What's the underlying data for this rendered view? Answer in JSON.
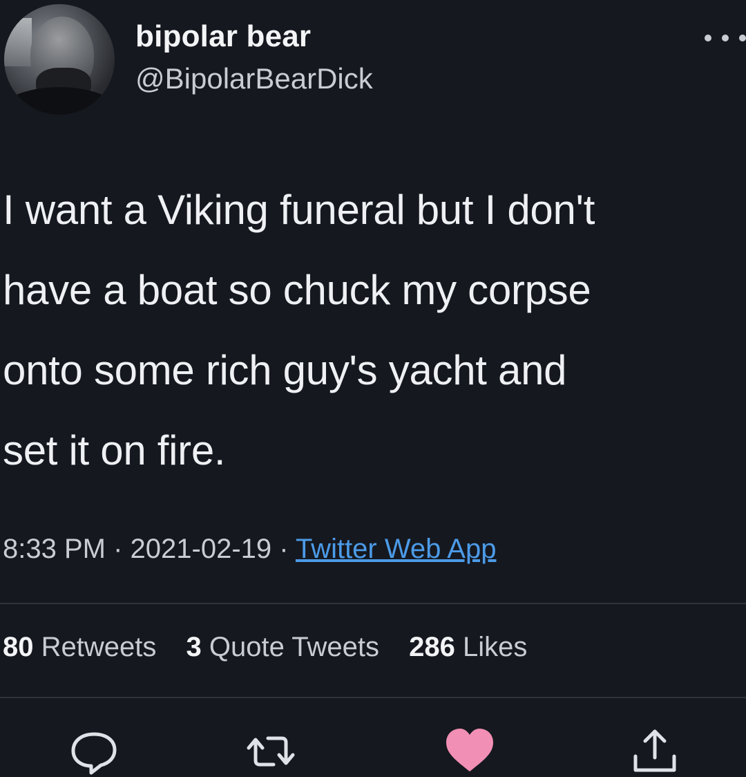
{
  "user": {
    "display_name": "bipolar bear",
    "handle": "@BipolarBearDick",
    "avatar_icon": "profile-photo"
  },
  "tweet": {
    "text_lines": [
      "I want a Viking funeral but I don't",
      "have a boat so chuck my corpse",
      "onto some rich guy's yacht and",
      "set it on fire."
    ]
  },
  "meta": {
    "time": "8:33 PM",
    "separator": " · ",
    "date": "2021-02-19",
    "source": "Twitter Web App"
  },
  "stats": {
    "retweets_count": "80",
    "retweets_label": "Retweets",
    "quotes_count": "3",
    "quotes_label": "Quote Tweets",
    "likes_count": "286",
    "likes_label": "Likes"
  },
  "actions": {
    "reply_icon": "reply-icon",
    "retweet_icon": "retweet-icon",
    "like_icon": "heart-icon",
    "share_icon": "share-icon",
    "like_color": "#f28fb4"
  },
  "colors": {
    "background": "#15181f",
    "link": "#4c9be8",
    "text": "#eef0f3",
    "muted": "#c9ccd2"
  }
}
